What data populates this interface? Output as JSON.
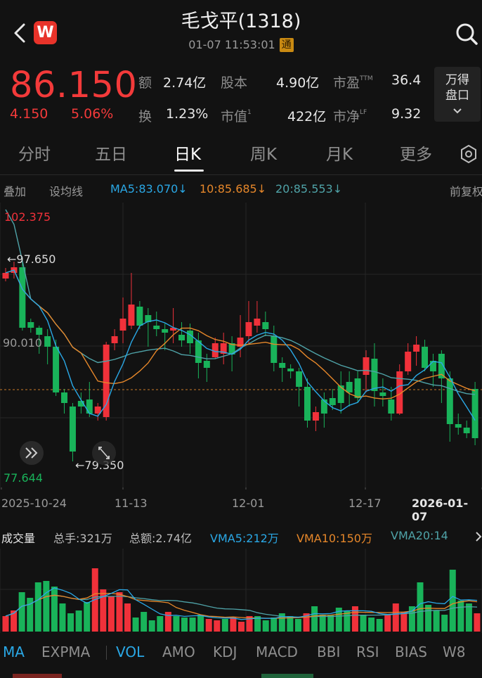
{
  "header": {
    "title": "毛戈平(1318)",
    "datetime": "01-07 11:53:01",
    "badge": "通",
    "logo_letter": "W"
  },
  "quote": {
    "price": "86.150",
    "change": "4.150",
    "change_pct": "5.06%",
    "stats": [
      {
        "label": "额",
        "value": "2.74亿",
        "sup": ""
      },
      {
        "label": "股本",
        "value": "4.90亿",
        "sup": ""
      },
      {
        "label": "市盈",
        "value": "36.4",
        "sup": "TTM"
      },
      {
        "label": "换",
        "value": "1.23%",
        "sup": ""
      },
      {
        "label": "市值",
        "value": "422亿",
        "sup": "1"
      },
      {
        "label": "市净",
        "value": "9.32",
        "sup": "LF"
      }
    ],
    "pankou_line1": "万得",
    "pankou_line2": "盘口"
  },
  "tabs": [
    "分时",
    "五日",
    "日K",
    "周K",
    "月K",
    "更多"
  ],
  "active_tab": "日K",
  "ma_bar": {
    "overlay": "叠加",
    "set_ma": "设均线",
    "ma5": "MA5:83.070↓",
    "ma10": "10:85.685↓",
    "ma20": "20:85.553↓",
    "adjust": "前复权"
  },
  "chart_labels": {
    "top_price": "102.375",
    "high_marker": "←97.650",
    "mid_price": "90.010",
    "low_marker": "←79.350",
    "bottom_price": "77.644"
  },
  "dates": [
    "2025-10-24",
    "11-13",
    "12-01",
    "12-17",
    "2026-01-07"
  ],
  "volume_bar": {
    "title": "成交量",
    "total_hands": "总手:321万",
    "total_amount": "总额:2.74亿",
    "vma5": "VMA5:212万",
    "vma10": "VMA10:150万",
    "vma20": "VMA20:14"
  },
  "indicators": [
    "MA",
    "EXPMA",
    "VOL",
    "AMO",
    "KDJ",
    "MACD",
    "BBI",
    "RSI",
    "BIAS",
    "W8"
  ],
  "active_indicator": "VOL",
  "colors": {
    "up": "#f0313a",
    "down": "#19b35a",
    "ma5": "#2aa8e6",
    "ma10": "#e6872a",
    "ma20": "#4fa3a8",
    "accent": "#e8332a"
  },
  "chart_data": {
    "type": "candlestick",
    "title": "毛戈平(1318) 日K",
    "x_range": [
      "2025-10-13",
      "2026-01-07"
    ],
    "y_range": [
      77.644,
      102.375
    ],
    "visible_candles": 60,
    "last_close": 86.15,
    "period_high": 97.65,
    "period_low": 79.35,
    "ma": {
      "MA5": 83.07,
      "MA10": 85.685,
      "MA20": 85.553
    },
    "volume": {
      "total_hands_wan": 321,
      "total_amount_yi": 2.74,
      "VMA5_wan": 212,
      "VMA10_wan": 150
    }
  }
}
